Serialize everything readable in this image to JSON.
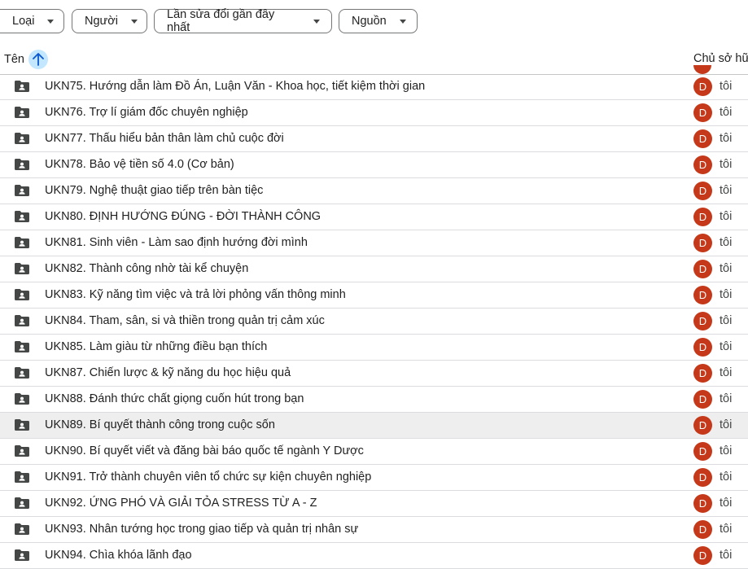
{
  "filters": [
    {
      "label": "Loại"
    },
    {
      "label": "Người"
    },
    {
      "label": "Lần sửa đổi gần đây nhất"
    },
    {
      "label": "Nguồn"
    }
  ],
  "header": {
    "name": "Tên",
    "owner": "Chủ sở hữ",
    "sort_icon": "arrow-up-icon"
  },
  "files": [
    {
      "name": "UKN75. Hướng dẫn làm Đồ Án, Luận Văn - Khoa học, tiết kiệm thời gian",
      "avatar": "D",
      "owner": "tôi"
    },
    {
      "name": "UKN76. Trợ lí giám đốc chuyên nghiệp",
      "avatar": "D",
      "owner": "tôi"
    },
    {
      "name": "UKN77. Thấu hiểu bản thân làm chủ cuộc đời",
      "avatar": "D",
      "owner": "tôi"
    },
    {
      "name": "UKN78. Bảo vệ tiền số 4.0 (Cơ bản)",
      "avatar": "D",
      "owner": "tôi"
    },
    {
      "name": "UKN79. Nghệ thuật giao tiếp trên bàn tiệc",
      "avatar": "D",
      "owner": "tôi"
    },
    {
      "name": "UKN80. ĐỊNH HƯỚNG ĐÚNG - ĐỜI THÀNH CÔNG",
      "avatar": "D",
      "owner": "tôi"
    },
    {
      "name": "UKN81. Sinh viên - Làm sao định hướng đời mình",
      "avatar": "D",
      "owner": "tôi"
    },
    {
      "name": "UKN82. Thành công nhờ tài kể chuyện",
      "avatar": "D",
      "owner": "tôi"
    },
    {
      "name": "UKN83. Kỹ năng tìm việc và trả lời phỏng vấn thông minh",
      "avatar": "D",
      "owner": "tôi"
    },
    {
      "name": "UKN84. Tham, sân, si và thiền trong quản trị cảm xúc",
      "avatar": "D",
      "owner": "tôi"
    },
    {
      "name": "UKN85. Làm giàu từ những điều bạn thích",
      "avatar": "D",
      "owner": "tôi"
    },
    {
      "name": "UKN87. Chiến lược & kỹ năng du học hiệu quả",
      "avatar": "D",
      "owner": "tôi"
    },
    {
      "name": "UKN88. Đánh thức chất giọng cuốn hút trong bạn",
      "avatar": "D",
      "owner": "tôi"
    },
    {
      "name": "UKN89. Bí quyết thành công trong cuộc sốn",
      "avatar": "D",
      "owner": "tôi"
    },
    {
      "name": "UKN90. Bí quyết viết và đăng bài báo quốc tế ngành Y Dược",
      "avatar": "D",
      "owner": "tôi"
    },
    {
      "name": "UKN91. Trở thành chuyên viên tổ chức sự kiện chuyên nghiệp",
      "avatar": "D",
      "owner": "tôi"
    },
    {
      "name": "UKN92. ỨNG PHÓ VÀ GIẢI TỎA STRESS TỪ A - Z",
      "avatar": "D",
      "owner": "tôi"
    },
    {
      "name": "UKN93. Nhân tướng học trong giao tiếp và quản trị nhân sự",
      "avatar": "D",
      "owner": "tôi"
    },
    {
      "name": "UKN94. Chìa khóa lãnh đạo",
      "avatar": "D",
      "owner": "tôi"
    }
  ],
  "icons": {
    "folder": "shared-folder-icon",
    "dropdown": "dropdown-caret-icon"
  },
  "colors": {
    "avatar_bg": "#c5391a",
    "sort_button_bg": "#c2e7ff",
    "selected_row_bg": "#eeeeee"
  }
}
